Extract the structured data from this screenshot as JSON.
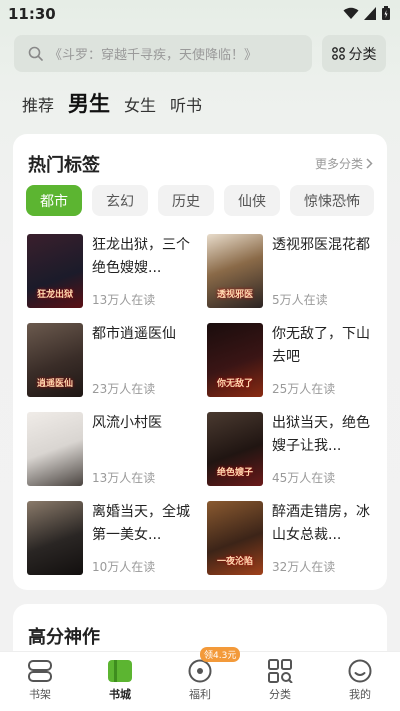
{
  "status": {
    "time": "11:30"
  },
  "search": {
    "placeholder": "《斗罗：穿越千寻疾，天使降临！》"
  },
  "category_button": {
    "label": "分类"
  },
  "top_tabs": [
    {
      "label": "推荐",
      "active": false
    },
    {
      "label": "男生",
      "active": true
    },
    {
      "label": "女生",
      "active": false
    },
    {
      "label": "听书",
      "active": false
    }
  ],
  "hot_tags": {
    "title": "热门标签",
    "more": "更多分类",
    "chips": [
      {
        "label": "都市",
        "active": true
      },
      {
        "label": "玄幻",
        "active": false
      },
      {
        "label": "历史",
        "active": false
      },
      {
        "label": "仙侠",
        "active": false
      },
      {
        "label": "惊悚恐怖",
        "active": false
      }
    ],
    "books": [
      {
        "title": "狂龙出狱，三个绝色嫂嫂...",
        "readers": "13万人在读",
        "cover_text": "狂龙出狱",
        "cover_color": "#1b1b2a"
      },
      {
        "title": "透视邪医混花都",
        "readers": "5万人在读",
        "cover_text": "透视邪医",
        "cover_color": "#2b2322"
      },
      {
        "title": "都市逍遥医仙",
        "readers": "23万人在读",
        "cover_text": "逍遥医仙",
        "cover_color": "#3a2d28"
      },
      {
        "title": "你无敌了，下山去吧",
        "readers": "25万人在读",
        "cover_text": "你无敌了",
        "cover_color": "#3a1515"
      },
      {
        "title": "风流小村医",
        "readers": "13万人在读",
        "cover_text": "",
        "cover_color": "#d9d5d1"
      },
      {
        "title": "出狱当天，绝色嫂子让我...",
        "readers": "45万人在读",
        "cover_text": "绝色嫂子",
        "cover_color": "#201512"
      },
      {
        "title": "离婚当天，全城第一美女...",
        "readers": "10万人在读",
        "cover_text": "",
        "cover_color": "#2a2624"
      },
      {
        "title": "醉酒走错房，冰山女总裁...",
        "readers": "32万人在读",
        "cover_text": "一夜沦陷",
        "cover_color": "#3c2418"
      }
    ]
  },
  "high_score": {
    "title": "高分神作"
  },
  "bottom_nav": [
    {
      "label": "书架",
      "icon": "bookshelf-icon",
      "active": false,
      "badge": ""
    },
    {
      "label": "书城",
      "icon": "bookstore-icon",
      "active": true,
      "badge": ""
    },
    {
      "label": "福利",
      "icon": "welfare-icon",
      "active": false,
      "badge": "领4.3元"
    },
    {
      "label": "分类",
      "icon": "category-icon",
      "active": false,
      "badge": ""
    },
    {
      "label": "我的",
      "icon": "profile-icon",
      "active": false,
      "badge": ""
    }
  ],
  "colors": {
    "accent": "#5cb531",
    "badge": "#f39a3a"
  }
}
